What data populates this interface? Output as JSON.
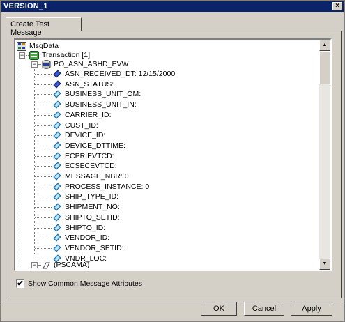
{
  "window": {
    "title": "VERSION_1",
    "close_label": "×"
  },
  "tab": {
    "label": "Create Test Message"
  },
  "tree": {
    "root": {
      "label": "MsgData",
      "icon": "msgdata-icon"
    },
    "transaction": {
      "label": "Transaction [1]",
      "icon": "transaction-icon",
      "expander": "−"
    },
    "record": {
      "label": "PO_ASN_ASHD_EVW",
      "icon": "record-icon",
      "expander": "−"
    },
    "fields": [
      {
        "label": "ASN_RECEIVED_DT: 12/15/2000",
        "icon": "key-field-icon"
      },
      {
        "label": "ASN_STATUS:",
        "icon": "key-field-icon"
      },
      {
        "label": "BUSINESS_UNIT_OM:",
        "icon": "field-icon"
      },
      {
        "label": "BUSINESS_UNIT_IN:",
        "icon": "field-icon"
      },
      {
        "label": "CARRIER_ID:",
        "icon": "field-icon"
      },
      {
        "label": "CUST_ID:",
        "icon": "field-icon"
      },
      {
        "label": "DEVICE_ID:",
        "icon": "field-icon"
      },
      {
        "label": "DEVICE_DTTIME:",
        "icon": "field-icon"
      },
      {
        "label": "ECPRIEVTCD:",
        "icon": "field-icon"
      },
      {
        "label": "ECSECEVTCD:",
        "icon": "field-icon"
      },
      {
        "label": "MESSAGE_NBR: 0",
        "icon": "field-icon"
      },
      {
        "label": "PROCESS_INSTANCE: 0",
        "icon": "field-icon"
      },
      {
        "label": "SHIP_TYPE_ID:",
        "icon": "field-icon"
      },
      {
        "label": "SHIPMENT_NO:",
        "icon": "field-icon"
      },
      {
        "label": "SHIPTO_SETID:",
        "icon": "field-icon"
      },
      {
        "label": "SHIPTO_ID:",
        "icon": "field-icon"
      },
      {
        "label": "VENDOR_ID:",
        "icon": "field-icon"
      },
      {
        "label": "VENDOR_SETID:",
        "icon": "field-icon"
      },
      {
        "label": "VNDR_LOC:",
        "icon": "field-icon"
      }
    ],
    "pscama": {
      "label": "(PSCAMA)",
      "icon": "pscama-icon",
      "expander": "−"
    }
  },
  "checkbox": {
    "label": "Show Common Message Attributes",
    "checked": true,
    "mark": "✔"
  },
  "buttons": {
    "ok": "OK",
    "cancel": "Cancel",
    "apply": "Apply"
  },
  "colors": {
    "titlebar": "#0a246a",
    "face": "#d4d0c8",
    "key_icon": "#1f3fa8",
    "field_icon": "#3aa0e0"
  }
}
